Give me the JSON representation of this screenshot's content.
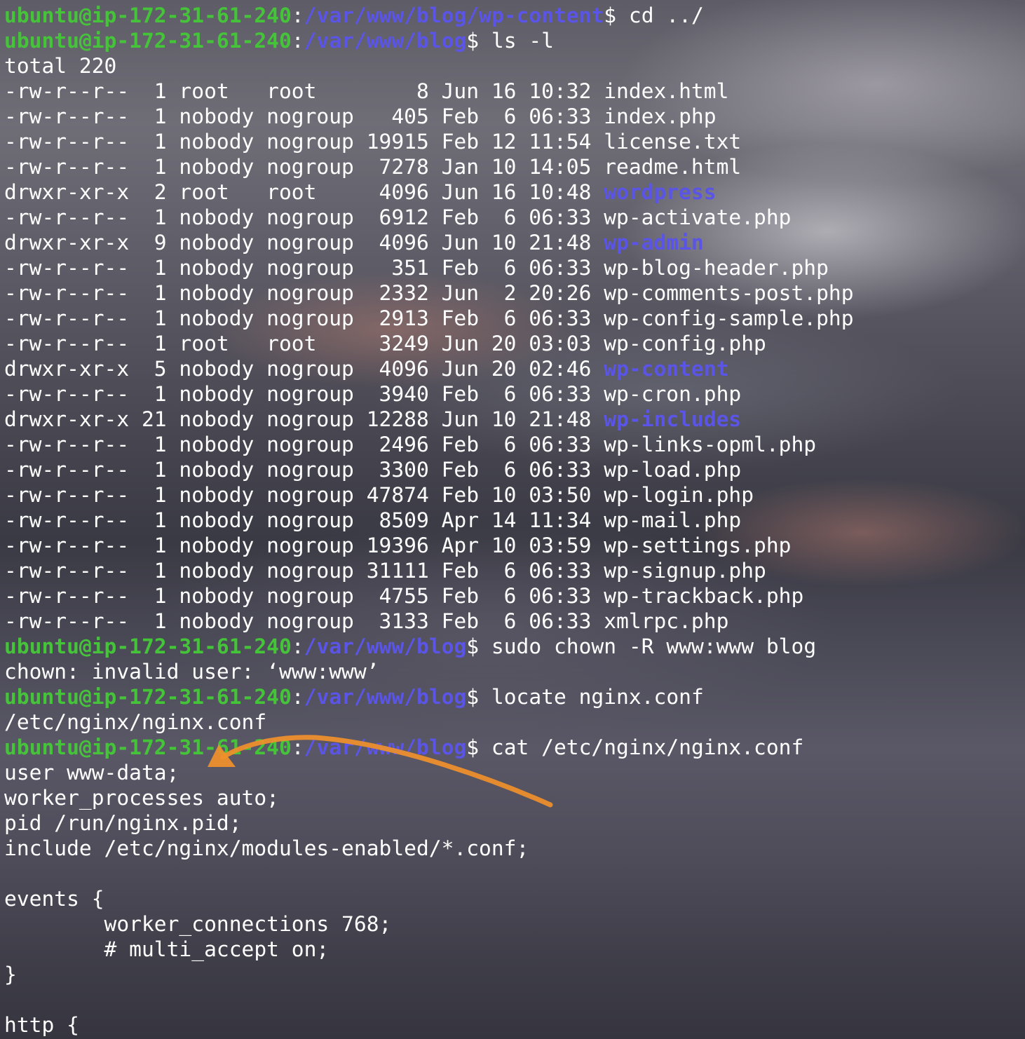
{
  "prompt": {
    "user_host": "ubuntu@ip-172-31-61-240",
    "separator": ":",
    "dollar": "$ "
  },
  "colors": {
    "prompt_user": "#45c43a",
    "path_and_directories": "#5a55e6",
    "annotation_arrow": "#f0902a"
  },
  "lines": [
    {
      "type": "prompt",
      "path": "/var/www/blog/wp-content",
      "command": "cd ../"
    },
    {
      "type": "prompt",
      "path": "/var/www/blog",
      "command": "ls -l"
    },
    {
      "type": "output",
      "text": "total 220"
    },
    {
      "type": "file",
      "meta": "-rw-r--r--  1 root   root        8 Jun 16 10:32 ",
      "name": "index.html",
      "dir": false
    },
    {
      "type": "file",
      "meta": "-rw-r--r--  1 nobody nogroup   405 Feb  6 06:33 ",
      "name": "index.php",
      "dir": false
    },
    {
      "type": "file",
      "meta": "-rw-r--r--  1 nobody nogroup 19915 Feb 12 11:54 ",
      "name": "license.txt",
      "dir": false
    },
    {
      "type": "file",
      "meta": "-rw-r--r--  1 nobody nogroup  7278 Jan 10 14:05 ",
      "name": "readme.html",
      "dir": false
    },
    {
      "type": "file",
      "meta": "drwxr-xr-x  2 root   root     4096 Jun 16 10:48 ",
      "name": "wordpress",
      "dir": true
    },
    {
      "type": "file",
      "meta": "-rw-r--r--  1 nobody nogroup  6912 Feb  6 06:33 ",
      "name": "wp-activate.php",
      "dir": false
    },
    {
      "type": "file",
      "meta": "drwxr-xr-x  9 nobody nogroup  4096 Jun 10 21:48 ",
      "name": "wp-admin",
      "dir": true
    },
    {
      "type": "file",
      "meta": "-rw-r--r--  1 nobody nogroup   351 Feb  6 06:33 ",
      "name": "wp-blog-header.php",
      "dir": false
    },
    {
      "type": "file",
      "meta": "-rw-r--r--  1 nobody nogroup  2332 Jun  2 20:26 ",
      "name": "wp-comments-post.php",
      "dir": false
    },
    {
      "type": "file",
      "meta": "-rw-r--r--  1 nobody nogroup  2913 Feb  6 06:33 ",
      "name": "wp-config-sample.php",
      "dir": false
    },
    {
      "type": "file",
      "meta": "-rw-r--r--  1 root   root     3249 Jun 20 03:03 ",
      "name": "wp-config.php",
      "dir": false
    },
    {
      "type": "file",
      "meta": "drwxr-xr-x  5 nobody nogroup  4096 Jun 20 02:46 ",
      "name": "wp-content",
      "dir": true
    },
    {
      "type": "file",
      "meta": "-rw-r--r--  1 nobody nogroup  3940 Feb  6 06:33 ",
      "name": "wp-cron.php",
      "dir": false
    },
    {
      "type": "file",
      "meta": "drwxr-xr-x 21 nobody nogroup 12288 Jun 10 21:48 ",
      "name": "wp-includes",
      "dir": true
    },
    {
      "type": "file",
      "meta": "-rw-r--r--  1 nobody nogroup  2496 Feb  6 06:33 ",
      "name": "wp-links-opml.php",
      "dir": false
    },
    {
      "type": "file",
      "meta": "-rw-r--r--  1 nobody nogroup  3300 Feb  6 06:33 ",
      "name": "wp-load.php",
      "dir": false
    },
    {
      "type": "file",
      "meta": "-rw-r--r--  1 nobody nogroup 47874 Feb 10 03:50 ",
      "name": "wp-login.php",
      "dir": false
    },
    {
      "type": "file",
      "meta": "-rw-r--r--  1 nobody nogroup  8509 Apr 14 11:34 ",
      "name": "wp-mail.php",
      "dir": false
    },
    {
      "type": "file",
      "meta": "-rw-r--r--  1 nobody nogroup 19396 Apr 10 03:59 ",
      "name": "wp-settings.php",
      "dir": false
    },
    {
      "type": "file",
      "meta": "-rw-r--r--  1 nobody nogroup 31111 Feb  6 06:33 ",
      "name": "wp-signup.php",
      "dir": false
    },
    {
      "type": "file",
      "meta": "-rw-r--r--  1 nobody nogroup  4755 Feb  6 06:33 ",
      "name": "wp-trackback.php",
      "dir": false
    },
    {
      "type": "file",
      "meta": "-rw-r--r--  1 nobody nogroup  3133 Feb  6 06:33 ",
      "name": "xmlrpc.php",
      "dir": false
    },
    {
      "type": "prompt",
      "path": "/var/www/blog",
      "command": "sudo chown -R www:www blog"
    },
    {
      "type": "output",
      "text": "chown: invalid user: ‘www:www’"
    },
    {
      "type": "prompt",
      "path": "/var/www/blog",
      "command": "locate nginx.conf"
    },
    {
      "type": "output",
      "text": "/etc/nginx/nginx.conf"
    },
    {
      "type": "prompt",
      "path": "/var/www/blog",
      "command": "cat /etc/nginx/nginx.conf"
    },
    {
      "type": "output",
      "text": "user www-data;"
    },
    {
      "type": "output",
      "text": "worker_processes auto;"
    },
    {
      "type": "output",
      "text": "pid /run/nginx.pid;"
    },
    {
      "type": "output",
      "text": "include /etc/nginx/modules-enabled/*.conf;"
    },
    {
      "type": "output",
      "text": ""
    },
    {
      "type": "output",
      "text": "events {"
    },
    {
      "type": "output",
      "text": "        worker_connections 768;"
    },
    {
      "type": "output",
      "text": "        # multi_accept on;"
    },
    {
      "type": "output",
      "text": "}"
    },
    {
      "type": "output",
      "text": ""
    },
    {
      "type": "output",
      "text": "http {"
    }
  ]
}
